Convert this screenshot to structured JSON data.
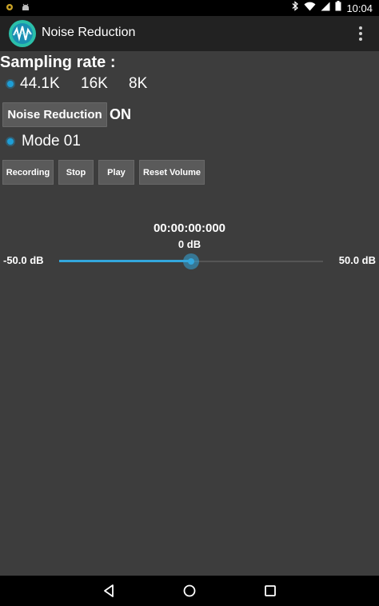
{
  "status_bar": {
    "time": "10:04",
    "left_icons": [
      "notification-icon",
      "android-debug-icon"
    ],
    "right_icons": [
      "bluetooth-icon",
      "wifi-icon",
      "signal-icon",
      "battery-icon"
    ]
  },
  "app_bar": {
    "title": "Noise Reduction",
    "logo_icon": "app-logo-icon",
    "menu_icon": "overflow-menu-icon"
  },
  "sampling": {
    "label": "Sampling rate :",
    "options": [
      "44.1K",
      "16K",
      "8K"
    ],
    "selected": "44.1K"
  },
  "noise_reduction": {
    "button_label": "Noise Reduction",
    "state": "ON"
  },
  "mode": {
    "label": "Mode 01"
  },
  "controls": {
    "recording": "Recording",
    "stop": "Stop",
    "play": "Play",
    "reset_volume": "Reset Volume"
  },
  "playback": {
    "timer": "00:00:00:000",
    "volume_db": "0 dB",
    "min_label": "-50.0 dB",
    "max_label": "50.0 dB",
    "min": -50,
    "max": 50,
    "value": 0
  },
  "colors": {
    "accent": "#33a7dd",
    "background": "#3d3d3d",
    "action_bar": "#222222",
    "button": "#5a5a5a"
  },
  "nav_bar": {
    "icons": [
      "back-icon",
      "home-icon",
      "recents-icon"
    ]
  }
}
